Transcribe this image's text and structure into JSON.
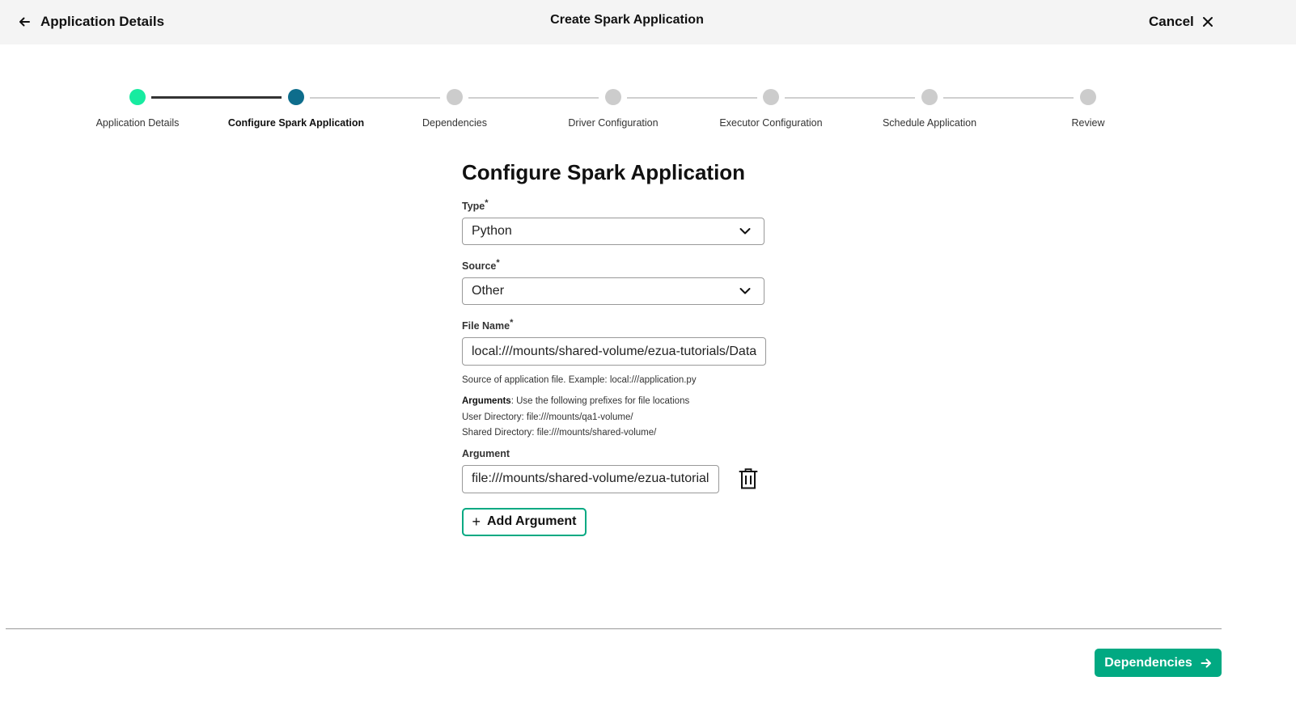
{
  "header": {
    "back_label": "Application Details",
    "title": "Create Spark Application",
    "cancel_label": "Cancel"
  },
  "stepper": {
    "steps": [
      {
        "label": "Application Details",
        "state": "complete"
      },
      {
        "label": "Configure Spark Application",
        "state": "current"
      },
      {
        "label": "Dependencies",
        "state": "pending"
      },
      {
        "label": "Driver Configuration",
        "state": "pending"
      },
      {
        "label": "Executor Configuration",
        "state": "pending"
      },
      {
        "label": "Schedule Application",
        "state": "pending"
      },
      {
        "label": "Review",
        "state": "pending"
      }
    ]
  },
  "form": {
    "heading": "Configure Spark Application",
    "type": {
      "label": "Type",
      "required_mark": "*",
      "value": "Python"
    },
    "source": {
      "label": "Source",
      "required_mark": "*",
      "value": "Other"
    },
    "file_name": {
      "label": "File Name",
      "required_mark": "*",
      "value": "local:///mounts/shared-volume/ezua-tutorials/Data-",
      "help": "Source of application file. Example: local:///application.py"
    },
    "arguments_note": {
      "title": "Arguments",
      "text": ": Use the following prefixes for file locations",
      "user_dir": "User Directory: file:///mounts/qa1-volume/",
      "shared_dir": "Shared Directory: file:///mounts/shared-volume/"
    },
    "argument": {
      "label": "Argument",
      "value": "file:///mounts/shared-volume/ezua-tutorials"
    },
    "add_argument_label": "Add Argument"
  },
  "footer": {
    "next_label": "Dependencies"
  },
  "colors": {
    "accent": "#01a982",
    "step_complete": "#17eba0",
    "step_current": "#0e6d8c",
    "step_pending": "#cccccc"
  },
  "icons": [
    "arrow-left-icon",
    "close-icon",
    "chevron-down-icon",
    "trash-icon",
    "plus-icon",
    "arrow-right-icon"
  ]
}
